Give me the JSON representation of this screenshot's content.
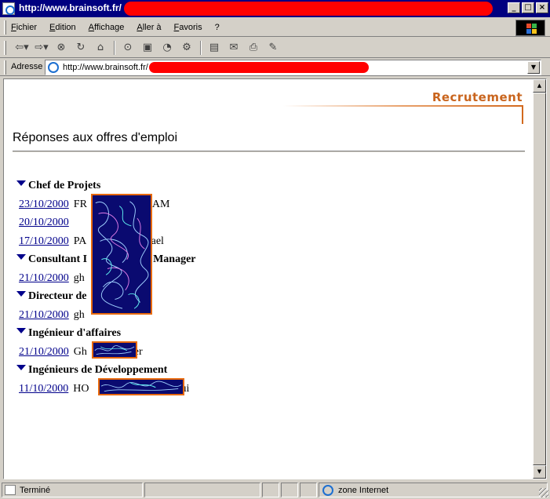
{
  "window": {
    "title": "http://www.brainsoft.fr/"
  },
  "menu": {
    "items": [
      "Fichier",
      "Edition",
      "Affichage",
      "Aller à",
      "Favoris",
      "?"
    ]
  },
  "toolbar": {
    "icons": [
      "back-icon",
      "forward-icon",
      "stop-icon",
      "refresh-icon",
      "home-icon",
      "search-icon",
      "favorites-icon",
      "history-icon",
      "channels-icon",
      "fullscreen-icon",
      "mail-icon",
      "print-icon",
      "edit-icon"
    ]
  },
  "address": {
    "label": "Adresse",
    "url": "http://www.brainsoft.fr/"
  },
  "page": {
    "section": "Recrutement",
    "title": "Réponses aux offres d'emploi",
    "categories": [
      {
        "title": "Chef de Projets",
        "entries": [
          {
            "date": "23/10/2000",
            "name": "FR",
            "name_tail": "AM"
          },
          {
            "date": "20/10/2000",
            "name": "",
            "name_tail": ""
          },
          {
            "date": "17/10/2000",
            "name": "PA",
            "name_tail": "chael"
          }
        ]
      },
      {
        "title": "Consultant I",
        "title_tail": "Manager",
        "entries": [
          {
            "date": "21/10/2000",
            "name": "gh",
            "name_tail": ""
          }
        ]
      },
      {
        "title": "Directeur de",
        "title_tail": "",
        "entries": [
          {
            "date": "21/10/2000",
            "name": "gh",
            "name_tail": ""
          }
        ]
      },
      {
        "title": "Ingénieur d'affaires",
        "entries": [
          {
            "date": "21/10/2000",
            "name": "Gh",
            "name_tail": "ier"
          }
        ]
      },
      {
        "title": "Ingénieurs de Développement",
        "entries": [
          {
            "date": "11/10/2000",
            "name": "HO",
            "name_tail": "gui"
          }
        ]
      }
    ]
  },
  "status": {
    "text": "Terminé",
    "zone": "zone Internet"
  },
  "colors": {
    "titlebar": "#000080",
    "link": "#00008b",
    "accent": "#c9651e",
    "redaction": "#ff0000",
    "scribble_bg": "#0a0a70",
    "scribble_border": "#e8690c"
  }
}
